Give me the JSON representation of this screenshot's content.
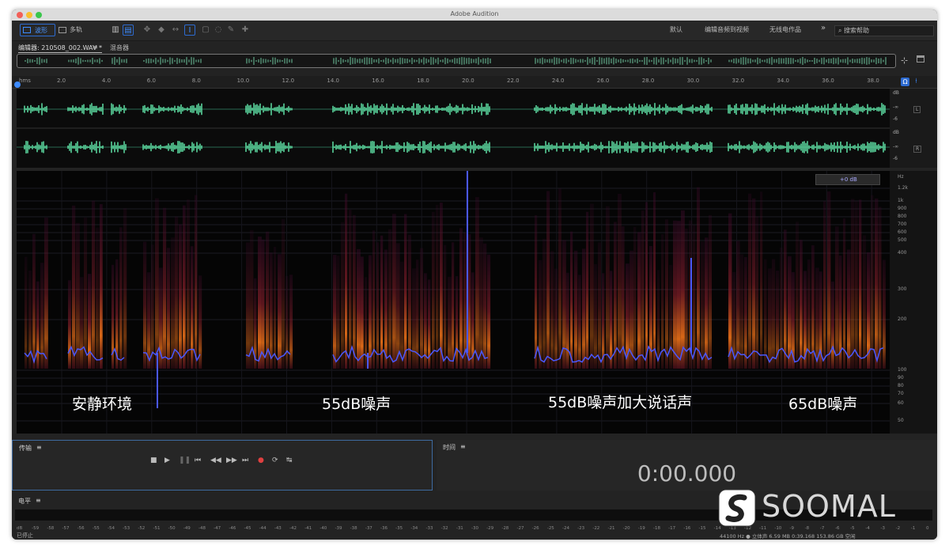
{
  "window": {
    "title": "Adobe Audition"
  },
  "toolbar": {
    "waveform_label": "波形",
    "multitrack_label": "多轨",
    "workspaces": [
      "默认",
      "编辑音频到视频",
      "无线电作品"
    ],
    "more": "»",
    "search_placeholder": "搜索帮助"
  },
  "editor": {
    "tab_label": "编辑器: 210508_002.WAV *",
    "mixer_label": "混音器"
  },
  "ruler": {
    "unit": "hms",
    "ticks": [
      "2.0",
      "4.0",
      "6.0",
      "8.0",
      "10.0",
      "12.0",
      "14.0",
      "16.0",
      "18.0",
      "20.0",
      "22.0",
      "24.0",
      "26.0",
      "28.0",
      "30.0",
      "32.0",
      "34.0",
      "36.0",
      "38.0"
    ]
  },
  "wave_scale": {
    "db": "dB",
    "neg_inf": "-∞",
    "m6": "-6",
    "left": "L",
    "right": "R"
  },
  "spectral": {
    "gain_label": "+0 dB",
    "hz_label": "Hz",
    "freq_ticks": [
      "1.2k",
      "1k",
      "900",
      "800",
      "700",
      "600",
      "500",
      "400",
      "300",
      "200",
      "100",
      "90",
      "80",
      "70",
      "60",
      "50"
    ]
  },
  "captions": [
    "安静环境",
    "55dB噪声",
    "55dB噪声加大说话声",
    "65dB噪声"
  ],
  "transport": {
    "title": "传输"
  },
  "time": {
    "title": "时间",
    "value": "0:00.000"
  },
  "levels": {
    "title": "电平",
    "ticks": [
      "dB",
      "-59",
      "-58",
      "-57",
      "-56",
      "-55",
      "-54",
      "-53",
      "-52",
      "-51",
      "-50",
      "-49",
      "-48",
      "-47",
      "-46",
      "-45",
      "-44",
      "-43",
      "-42",
      "-41",
      "-40",
      "-39",
      "-38",
      "-37",
      "-36",
      "-35",
      "-34",
      "-33",
      "-32",
      "-31",
      "-30",
      "-29",
      "-28",
      "-27",
      "-26",
      "-25",
      "-24",
      "-23",
      "-22",
      "-21",
      "-20",
      "-19",
      "-18",
      "-17",
      "-16",
      "-15",
      "-14",
      "-13",
      "-12",
      "-11",
      "-10",
      "-9",
      "-8",
      "-7",
      "-6",
      "-5",
      "-4",
      "-3",
      "-2",
      "-1",
      "0"
    ]
  },
  "status": {
    "state": "已停止",
    "info": "44100 Hz ● 立体声   6.59 MB   0:39.168   153.86 GB 空闲"
  },
  "watermark": {
    "text": "SOOMAL"
  },
  "colors": {
    "wave": "#5ee0a4",
    "pitch": "#4a58ff",
    "spec_hot": "#ff8a1a",
    "panel_border": "#3d6aa0"
  }
}
